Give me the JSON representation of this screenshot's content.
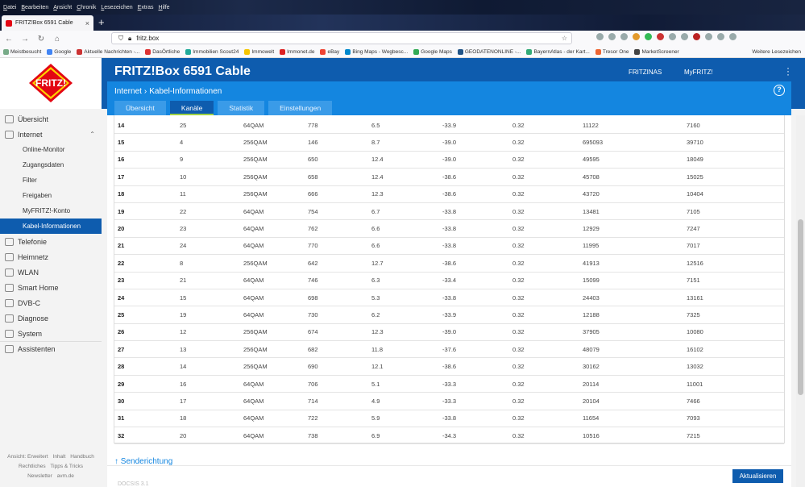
{
  "browser": {
    "menu": [
      "Datei",
      "Bearbeiten",
      "Ansicht",
      "Chronik",
      "Lesezeichen",
      "Extras",
      "Hilfe"
    ],
    "tab_title": "FRITZ!Box 6591 Cable",
    "url": "fritz.box",
    "bookmarks": [
      "Meistbesucht",
      "Google",
      "Aktuelle Nachrichten -...",
      "DasÖrtliche",
      "Immobilien Scout24",
      "Immowelt",
      "Immonet.de",
      "eBay",
      "Bing Maps - Wegbesc...",
      "Google Maps",
      "GEODATENONLINE -...",
      "BayernAtlas - der Kart...",
      "Tresor One",
      "MarketScreener"
    ],
    "bookmarks_other": "Weitere Lesezeichen"
  },
  "header": {
    "logo_text": "FRITZ!",
    "product": "FRITZ!Box 6591 Cable",
    "links": [
      "FRITZINAS",
      "MyFRITZ!"
    ],
    "breadcrumb": [
      "Internet",
      "Kabel-Informationen"
    ],
    "help": "?",
    "tabs": [
      "Übersicht",
      "Kanäle",
      "Statistik",
      "Einstellungen"
    ],
    "active_tab": "Kanäle"
  },
  "sidebar": {
    "items": [
      {
        "label": "Übersicht",
        "level": 0
      },
      {
        "label": "Internet",
        "level": 0,
        "expanded": true
      },
      {
        "label": "Online-Monitor",
        "level": 1
      },
      {
        "label": "Zugangsdaten",
        "level": 1
      },
      {
        "label": "Filter",
        "level": 1
      },
      {
        "label": "Freigaben",
        "level": 1
      },
      {
        "label": "MyFRITZ!-Konto",
        "level": 1
      },
      {
        "label": "Kabel-Informationen",
        "level": 1,
        "active": true
      },
      {
        "label": "Telefonie",
        "level": 0
      },
      {
        "label": "Heimnetz",
        "level": 0
      },
      {
        "label": "WLAN",
        "level": 0
      },
      {
        "label": "Smart Home",
        "level": 0
      },
      {
        "label": "DVB-C",
        "level": 0
      },
      {
        "label": "Diagnose",
        "level": 0
      },
      {
        "label": "System",
        "level": 0
      },
      {
        "label": "Assistenten",
        "level": 0
      }
    ],
    "footer_line1": [
      "Ansicht: Erweitert",
      "Inhalt",
      "Handbuch"
    ],
    "footer_line2": [
      "Rechtliches",
      "Tipps & Tricks"
    ],
    "footer_line3": [
      "Newsletter",
      "avm.de"
    ]
  },
  "table": {
    "rows": [
      [
        "14",
        "25",
        "64QAM",
        "778",
        "6.5",
        "-33.9",
        "0.32",
        "11122",
        "7160"
      ],
      [
        "15",
        "4",
        "256QAM",
        "146",
        "8.7",
        "-39.0",
        "0.32",
        "695093",
        "39710"
      ],
      [
        "16",
        "9",
        "256QAM",
        "650",
        "12.4",
        "-39.0",
        "0.32",
        "49595",
        "18049"
      ],
      [
        "17",
        "10",
        "256QAM",
        "658",
        "12.4",
        "-38.6",
        "0.32",
        "45708",
        "15025"
      ],
      [
        "18",
        "11",
        "256QAM",
        "666",
        "12.3",
        "-38.6",
        "0.32",
        "43720",
        "10404"
      ],
      [
        "19",
        "22",
        "64QAM",
        "754",
        "6.7",
        "-33.8",
        "0.32",
        "13481",
        "7105"
      ],
      [
        "20",
        "23",
        "64QAM",
        "762",
        "6.6",
        "-33.8",
        "0.32",
        "12929",
        "7247"
      ],
      [
        "21",
        "24",
        "64QAM",
        "770",
        "6.6",
        "-33.8",
        "0.32",
        "11995",
        "7017"
      ],
      [
        "22",
        "8",
        "256QAM",
        "642",
        "12.7",
        "-38.6",
        "0.32",
        "41913",
        "12516"
      ],
      [
        "23",
        "21",
        "64QAM",
        "746",
        "6.3",
        "-33.4",
        "0.32",
        "15099",
        "7151"
      ],
      [
        "24",
        "15",
        "64QAM",
        "698",
        "5.3",
        "-33.8",
        "0.32",
        "24403",
        "13161"
      ],
      [
        "25",
        "19",
        "64QAM",
        "730",
        "6.2",
        "-33.9",
        "0.32",
        "12188",
        "7325"
      ],
      [
        "26",
        "12",
        "256QAM",
        "674",
        "12.3",
        "-39.0",
        "0.32",
        "37905",
        "10080"
      ],
      [
        "27",
        "13",
        "256QAM",
        "682",
        "11.8",
        "-37.6",
        "0.32",
        "48079",
        "16102"
      ],
      [
        "28",
        "14",
        "256QAM",
        "690",
        "12.1",
        "-38.6",
        "0.32",
        "30162",
        "13032"
      ],
      [
        "29",
        "16",
        "64QAM",
        "706",
        "5.1",
        "-33.3",
        "0.32",
        "20114",
        "11001"
      ],
      [
        "30",
        "17",
        "64QAM",
        "714",
        "4.9",
        "-33.3",
        "0.32",
        "20104",
        "7466"
      ],
      [
        "31",
        "18",
        "64QAM",
        "722",
        "5.9",
        "-33.8",
        "0.32",
        "11654",
        "7093"
      ],
      [
        "32",
        "20",
        "64QAM",
        "738",
        "6.9",
        "-34.3",
        "0.32",
        "10516",
        "7215"
      ]
    ]
  },
  "content": {
    "section_link": "↑ Senderichtung",
    "next_section": "DOCSIS 3.1",
    "apply_button": "Aktualisieren"
  },
  "colors": {
    "brand_dark": "#0e5cae",
    "brand_light": "#1486e0",
    "tab_active_underline": "#9fd244",
    "logo_red": "#e30613"
  }
}
